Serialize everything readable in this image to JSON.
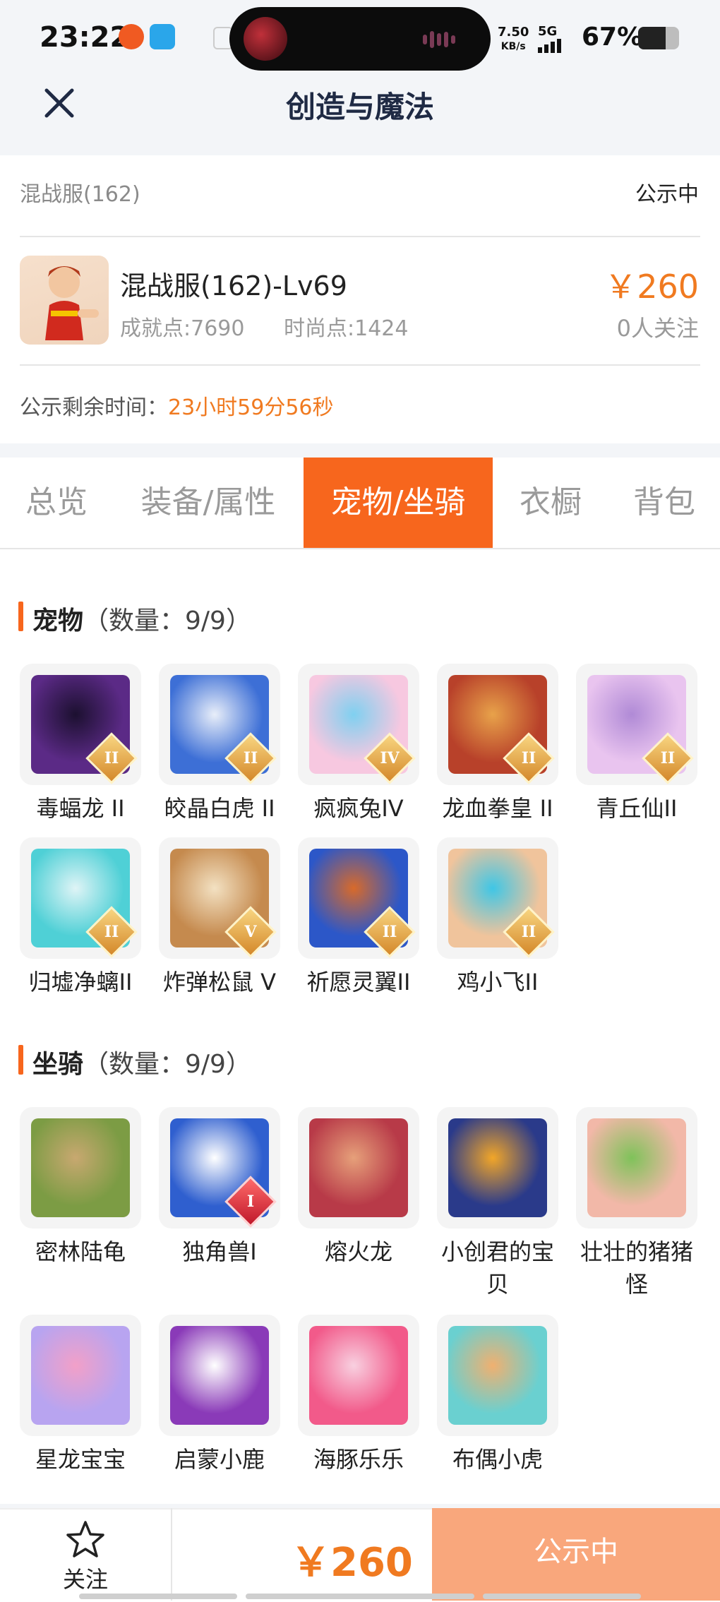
{
  "status_bar": {
    "time": "23:22",
    "speed_value": "7.50",
    "speed_unit": "KB/s",
    "network": "5G",
    "battery": "67%",
    "battery_level": 0.67
  },
  "header": {
    "title": "创造与魔法"
  },
  "listing": {
    "server": "混战服(162)",
    "status": "公示中",
    "character": "混战服(162)-Lv69",
    "achievement": "成就点:7690",
    "fashion": "时尚点:1424",
    "price": "￥260",
    "followers": "0人关注",
    "remaining_label": "公示剩余时间：",
    "remaining_value": "23小时59分56秒"
  },
  "tabs": [
    {
      "label": "总览"
    },
    {
      "label": "装备/属性"
    },
    {
      "label": "宠物/坐骑"
    },
    {
      "label": "衣橱"
    },
    {
      "label": "背包"
    }
  ],
  "active_tab": "宠物/坐骑",
  "pets": {
    "title": "宠物",
    "count": "（数量：9/9）",
    "items": [
      {
        "name": "毒蝠龙 II",
        "badge": "II"
      },
      {
        "name": "皎晶白虎 II",
        "badge": "II"
      },
      {
        "name": "疯疯兔IV",
        "badge": "IV"
      },
      {
        "name": "龙血拳皇 II",
        "badge": "II"
      },
      {
        "name": "青丘仙II",
        "badge": "II"
      },
      {
        "name": "归墟净螭II",
        "badge": "II"
      },
      {
        "name": "炸弹松鼠 V",
        "badge": "V"
      },
      {
        "name": "祈愿灵翼II",
        "badge": "II"
      },
      {
        "name": "鸡小飞II",
        "badge": "II"
      }
    ]
  },
  "mounts": {
    "title": "坐骑",
    "count": "（数量：9/9）",
    "items": [
      {
        "name": "密林陆龟"
      },
      {
        "name": "独角兽I",
        "badge": "I"
      },
      {
        "name": "熔火龙"
      },
      {
        "name": "小创君的宝贝"
      },
      {
        "name": "壮壮的猪猪怪"
      },
      {
        "name": "星龙宝宝"
      },
      {
        "name": "启蒙小鹿"
      },
      {
        "name": "海豚乐乐"
      },
      {
        "name": "布偶小虎"
      }
    ]
  },
  "bottom": {
    "follow_label": "关注",
    "price": "￥260",
    "action_label": "公示中"
  },
  "colors": {
    "accent": "#f7661d",
    "price": "#f07a20",
    "action": "#f9a77c"
  }
}
